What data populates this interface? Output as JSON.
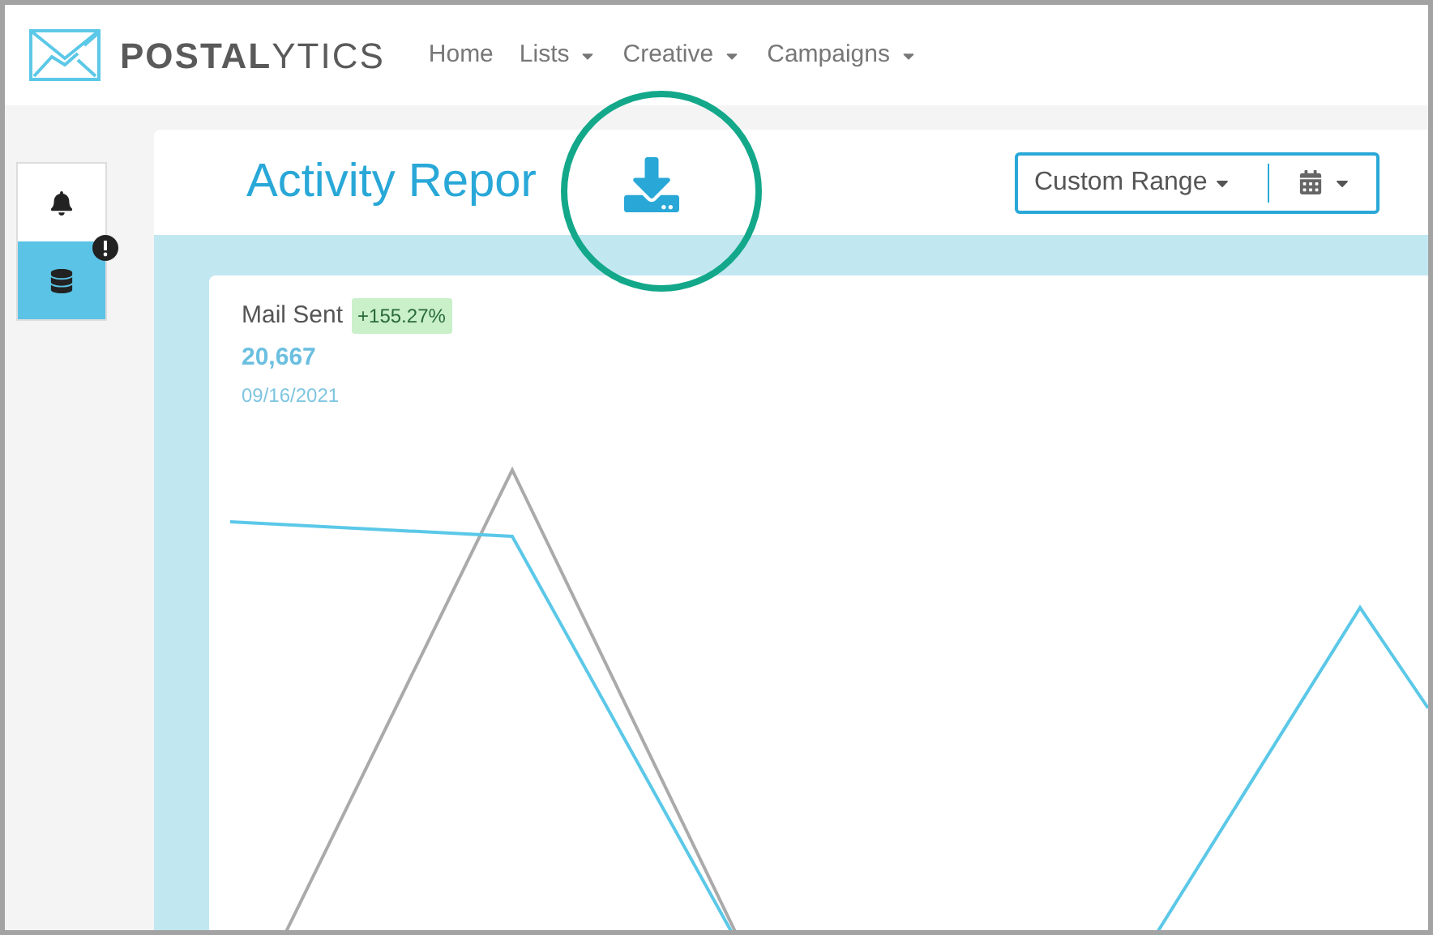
{
  "brand": {
    "name_bold": "POSTAL",
    "name_light": "YTICS"
  },
  "nav": [
    {
      "label": "Home",
      "dropdown": false
    },
    {
      "label": "Lists",
      "dropdown": true
    },
    {
      "label": "Creative",
      "dropdown": true
    },
    {
      "label": "Campaigns",
      "dropdown": true
    }
  ],
  "sidebar": {
    "items": [
      {
        "kind": "bell",
        "selected": false,
        "alert": false
      },
      {
        "kind": "database",
        "selected": true,
        "alert": true
      }
    ]
  },
  "report": {
    "title": "Activity Repor",
    "range": {
      "label": "Custom Range"
    }
  },
  "card": {
    "metric": "Mail Sent",
    "change": "+155.27%",
    "value": "20,667",
    "date": "09/16/2021"
  }
}
